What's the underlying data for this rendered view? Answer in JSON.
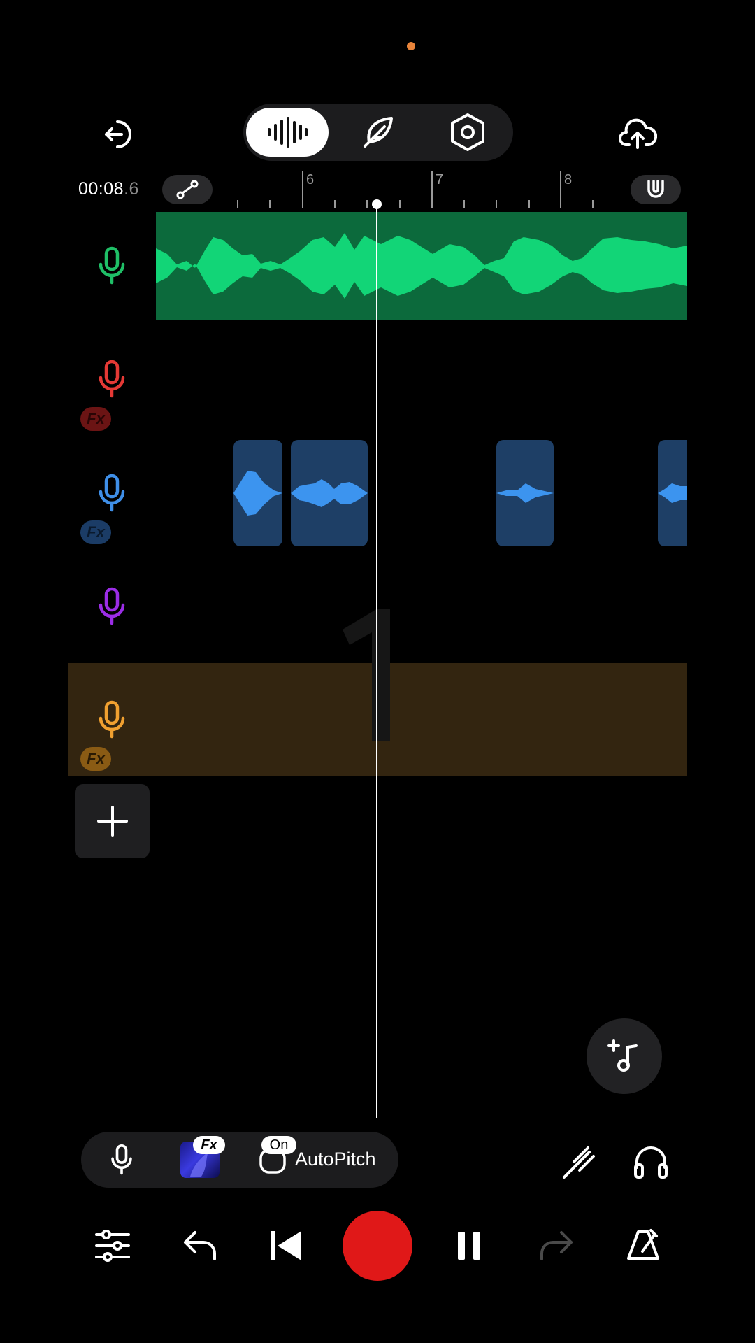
{
  "header": {
    "mode_tabs": [
      "waveform",
      "feather",
      "settings-hex"
    ],
    "time_main": "00:08",
    "time_fraction": ".6"
  },
  "ruler": {
    "labels": [
      "6",
      "7",
      "8"
    ]
  },
  "tracks": [
    {
      "color": "#1fbf67",
      "fx": ""
    },
    {
      "color": "#e53935",
      "fx": "Fx"
    },
    {
      "color": "#3f8fe8",
      "fx": "Fx"
    },
    {
      "color": "#9b2de6",
      "fx": ""
    },
    {
      "color": "#f0a030",
      "fx": "Fx"
    }
  ],
  "bottom_bar": {
    "fx_badge": "Fx",
    "on_badge": "On",
    "autopitch_label": "AutoPitch"
  },
  "icons": {
    "back": "exit-icon",
    "upload": "cloud-upload-icon",
    "magnet": "magnet-icon",
    "curve": "automation-curve-icon",
    "add_music": "add-music-icon",
    "tuner": "tuning-fork-icon",
    "headphones": "headphones-icon",
    "mixer": "mixer-sliders-icon",
    "undo": "undo-icon",
    "skip_back": "skip-back-icon",
    "record": "record-icon",
    "pause": "pause-icon",
    "redo": "redo-icon",
    "metronome": "metronome-icon"
  }
}
